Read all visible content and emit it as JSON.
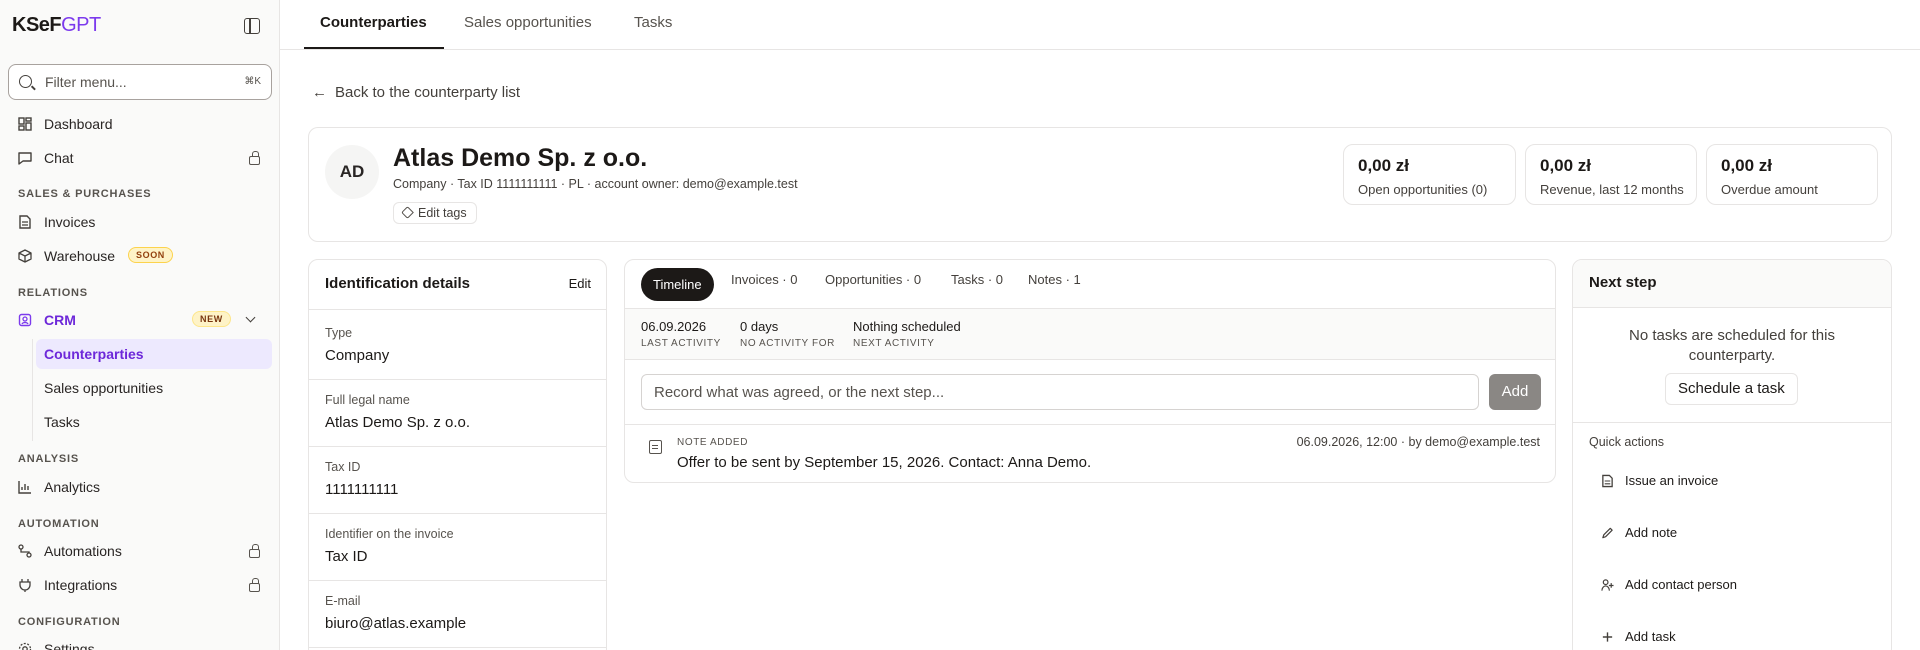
{
  "brand": {
    "prefix": "KSeF",
    "suffix": "GPT"
  },
  "filter": {
    "placeholder": "Filter menu...",
    "shortcut": "⌘K"
  },
  "nav": {
    "dashboard": "Dashboard",
    "chat": "Chat",
    "sec_sales": "SALES & PURCHASES",
    "invoices": "Invoices",
    "warehouse": "Warehouse",
    "warehouse_badge": "SOON",
    "sec_relations": "RELATIONS",
    "crm": "CRM",
    "crm_badge": "NEW",
    "counterparties": "Counterparties",
    "sales_opportunities": "Sales opportunities",
    "tasks": "Tasks",
    "sec_analysis": "ANALYSIS",
    "analytics": "Analytics",
    "sec_automation": "AUTOMATION",
    "automations": "Automations",
    "integrations": "Integrations",
    "sec_configuration": "CONFIGURATION",
    "settings": "Settings"
  },
  "tabs": [
    "Counterparties",
    "Sales opportunities",
    "Tasks"
  ],
  "back_link": "Back to the counterparty list",
  "company": {
    "initials": "AD",
    "name": "Atlas Demo Sp. z o.o.",
    "meta": "Company · Tax ID 1111111111 · PL · account owner: demo@example.test",
    "edit_tags": "Edit tags"
  },
  "stats": [
    {
      "value": "0,00 zł",
      "label": "Open opportunities (0)"
    },
    {
      "value": "0,00 zł",
      "label": "Revenue, last 12 months"
    },
    {
      "value": "0,00 zł",
      "label": "Overdue amount"
    }
  ],
  "ident": {
    "title": "Identification details",
    "edit": "Edit",
    "fields": [
      {
        "label": "Type",
        "value": "Company"
      },
      {
        "label": "Full legal name",
        "value": "Atlas Demo Sp. z o.o."
      },
      {
        "label": "Tax ID",
        "value": "1111111111"
      },
      {
        "label": "Identifier on the invoice",
        "value": "Tax ID"
      },
      {
        "label": "E-mail",
        "value": "biuro@atlas.example"
      }
    ]
  },
  "timeline": {
    "tabs": [
      "Timeline",
      "Invoices · 0",
      "Opportunities · 0",
      "Tasks · 0",
      "Notes · 1"
    ],
    "last_activity": {
      "value": "06.09.2026",
      "key": "LAST ACTIVITY"
    },
    "no_activity": {
      "value": "0 days",
      "key": "NO ACTIVITY FOR"
    },
    "next_activity": {
      "value": "Nothing scheduled",
      "key": "NEXT ACTIVITY"
    },
    "input_placeholder": "Record what was agreed, or the next step...",
    "add_label": "Add",
    "note": {
      "kind": "NOTE ADDED",
      "meta": "06.09.2026, 12:00 · by demo@example.test",
      "text": "Offer to be sent by September 15, 2026. Contact: Anna Demo."
    }
  },
  "next_step": {
    "title": "Next step",
    "empty": "No tasks are scheduled for this counterparty.",
    "schedule": "Schedule a task",
    "quick_title": "Quick actions",
    "actions": [
      "Issue an invoice",
      "Add note",
      "Add contact person",
      "Add task"
    ]
  }
}
